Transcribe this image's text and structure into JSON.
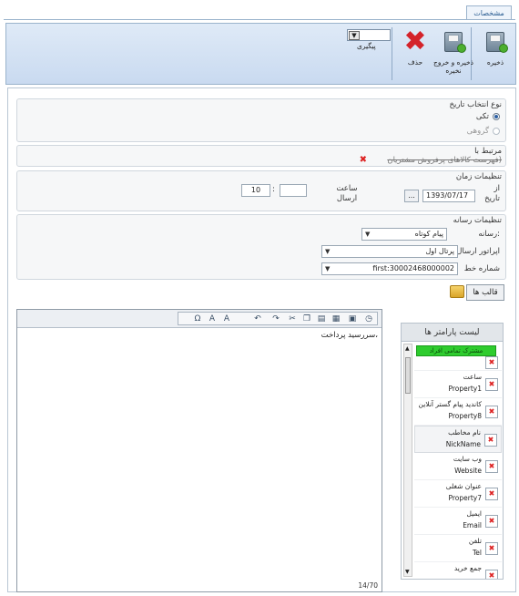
{
  "tab": {
    "label": "مشخصات"
  },
  "toolbar": {
    "save": "ذخیره",
    "save_exit": "ذخیره و خروج",
    "save_exit_line2": "نخیره",
    "delete": "حذف",
    "followup_label": "پیگیری"
  },
  "date_type": {
    "title": "نوع انتخاب تاریخ",
    "single": "تکی",
    "group": "گروهی"
  },
  "related": {
    "title": "مرتبط با",
    "value": "فهرست کالاهای پرفروش مشتریان)"
  },
  "time_settings": {
    "title": "تنظیمات زمان",
    "from_label_1": "از",
    "from_label_2": "تاریخ",
    "date_value": "1393/07/17",
    "date_btn": "...",
    "send_time_label_1": "ساعت",
    "send_time_label_2": "ارسال",
    "hour": "10",
    "colon": ":",
    "minute": ""
  },
  "media_settings": {
    "title": "تنظیمات رسانه",
    "media_label": "رسانه:",
    "media_value": "پیام کوتاه",
    "operator_label": "اپراتور ارسال",
    "operator_value": "پرتال اول",
    "line_label": "شماره خط",
    "line_value": "first:30002468000002"
  },
  "templates_button": "قالب ها",
  "editor": {
    "text": "سررسید پرداخت،",
    "counter": "14/70"
  },
  "params": {
    "title": "لیست پارامتر ها",
    "items": [
      {
        "name": "مشترک تمامی افراد",
        "code": ""
      },
      {
        "name": "ساعت",
        "code": "Property1"
      },
      {
        "name": "کاندید پیام گستر آنلاین",
        "code": "Property8"
      },
      {
        "name": "نام مخاطب",
        "code": "NickName"
      },
      {
        "name": "وب سایت",
        "code": "Website"
      },
      {
        "name": "عنوان شغلی",
        "code": "Property7"
      },
      {
        "name": "ایمیل",
        "code": "Email"
      },
      {
        "name": "تلفن",
        "code": "Tel"
      },
      {
        "name": "جمع خرید",
        "code": ""
      }
    ]
  }
}
